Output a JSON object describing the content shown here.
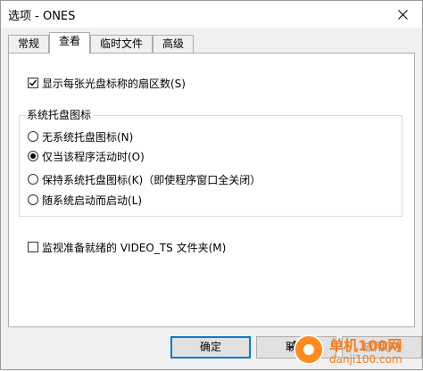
{
  "window": {
    "title": "选项 - ONES",
    "close_icon": "close-icon"
  },
  "tabs": [
    {
      "label": "常规",
      "active": false
    },
    {
      "label": "查看",
      "active": true
    },
    {
      "label": "临时文件",
      "active": false
    },
    {
      "label": "高级",
      "active": false
    }
  ],
  "options": {
    "show_sector_count": {
      "label": "显示每张光盘标称的扇区数(S)",
      "checked": true
    }
  },
  "tray_group": {
    "title": "系统托盘图标",
    "radios": [
      {
        "label": "无系统托盘图标(N)",
        "selected": false
      },
      {
        "label": "仅当该程序活动时(O)",
        "selected": true
      },
      {
        "label": "保持系统托盘图标(K)（即使程序窗口全关闭）",
        "selected": false
      },
      {
        "label": "随系统启动而启动(L)",
        "selected": false
      }
    ]
  },
  "monitor_video_ts": {
    "label": "监视准备就绪的 VIDEO_TS 文件夹(M)",
    "checked": false
  },
  "buttons": {
    "ok": "确定",
    "cancel": "取消",
    "apply": "应用(A)"
  },
  "watermark": {
    "text_top": "单机100网",
    "text_bottom": "danji100.com",
    "plus": "+"
  },
  "colors": {
    "accent": "#0078d7",
    "watermark": "#ff7a14"
  }
}
